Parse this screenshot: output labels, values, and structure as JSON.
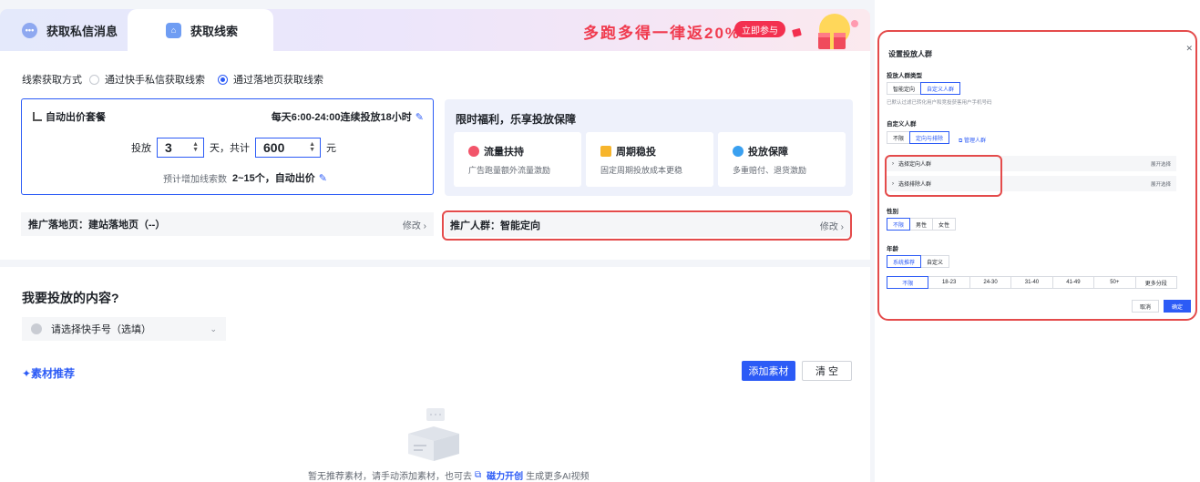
{
  "tabs": [
    {
      "label": "获取私信消息",
      "active": false
    },
    {
      "label": "获取线索",
      "active": true
    }
  ],
  "promo": {
    "text": "多跑多得一律返20%",
    "button": "立即参与"
  },
  "lead_method": {
    "label": "线索获取方式",
    "options": [
      {
        "label": "通过快手私信获取线索",
        "selected": false
      },
      {
        "label": "通过落地页获取线索",
        "selected": true
      }
    ]
  },
  "bid": {
    "title": "自动出价套餐",
    "schedule": "每天6:00-24:00连续投放18小时",
    "prefix": "投放",
    "days_value": "3",
    "days_unit": "天，共计",
    "amount_value": "600",
    "amount_unit": "元",
    "estimate_prefix": "预计增加线索数",
    "estimate_value": "2~15个，自动出价"
  },
  "welfare": {
    "title": "限时福利，乐享投放保障",
    "cards": [
      {
        "title": "流量扶持",
        "desc": "广告跑量额外流量激励"
      },
      {
        "title": "周期稳投",
        "desc": "固定周期投放成本更稳"
      },
      {
        "title": "投放保障",
        "desc": "多重赔付、退货激励"
      }
    ]
  },
  "landing": {
    "label": "推广落地页：建站落地页（--）",
    "action": "修改 ›"
  },
  "audience": {
    "label": "推广人群：智能定向",
    "action": "修改 ›"
  },
  "content": {
    "title": "我要投放的内容?",
    "account_placeholder": "请选择快手号（选填）",
    "material_rec": "✦素材推荐",
    "add_material": "添加素材",
    "clear": "清 空",
    "empty_text_1": "暂无推荐素材，请手动添加素材，也可去",
    "empty_link": "磁力开创",
    "empty_text_2": "生成更多AI视频"
  },
  "panel": {
    "title": "设置投放人群",
    "audience_type_label": "投放人群类型",
    "audience_type_options": [
      {
        "label": "智能定向",
        "on": false
      },
      {
        "label": "自定义人群",
        "on": true
      }
    ],
    "hint": "已默认过滤已转化用户和竞投获客用户手机号码",
    "custom_label": "自定义人群",
    "custom_options": [
      {
        "label": "不限",
        "on": false
      },
      {
        "label": "定向与排除",
        "on": true
      }
    ],
    "manage_link": "管理人群",
    "rows": [
      {
        "label": "选择定向人群",
        "expand": "展开选择"
      },
      {
        "label": "选择排除人群",
        "expand": "展开选择"
      }
    ],
    "gender_label": "性别",
    "gender_options": [
      {
        "label": "不限",
        "on": true
      },
      {
        "label": "男性",
        "on": false
      },
      {
        "label": "女性",
        "on": false
      }
    ],
    "age_label": "年龄",
    "age_mode_options": [
      {
        "label": "系统推荐",
        "on": true
      },
      {
        "label": "自定义",
        "on": false
      }
    ],
    "age_ranges": [
      {
        "label": "不限",
        "on": true
      },
      {
        "label": "18-23",
        "on": false
      },
      {
        "label": "24-30",
        "on": false
      },
      {
        "label": "31-40",
        "on": false
      },
      {
        "label": "41-49",
        "on": false
      },
      {
        "label": "50+",
        "on": false
      },
      {
        "label": "更多分段",
        "on": false
      }
    ],
    "cancel": "取消",
    "confirm": "确定"
  },
  "colors": {
    "accent": "#2c5bf6",
    "highlight": "#e44b4b",
    "promo": "#f03a4e"
  }
}
